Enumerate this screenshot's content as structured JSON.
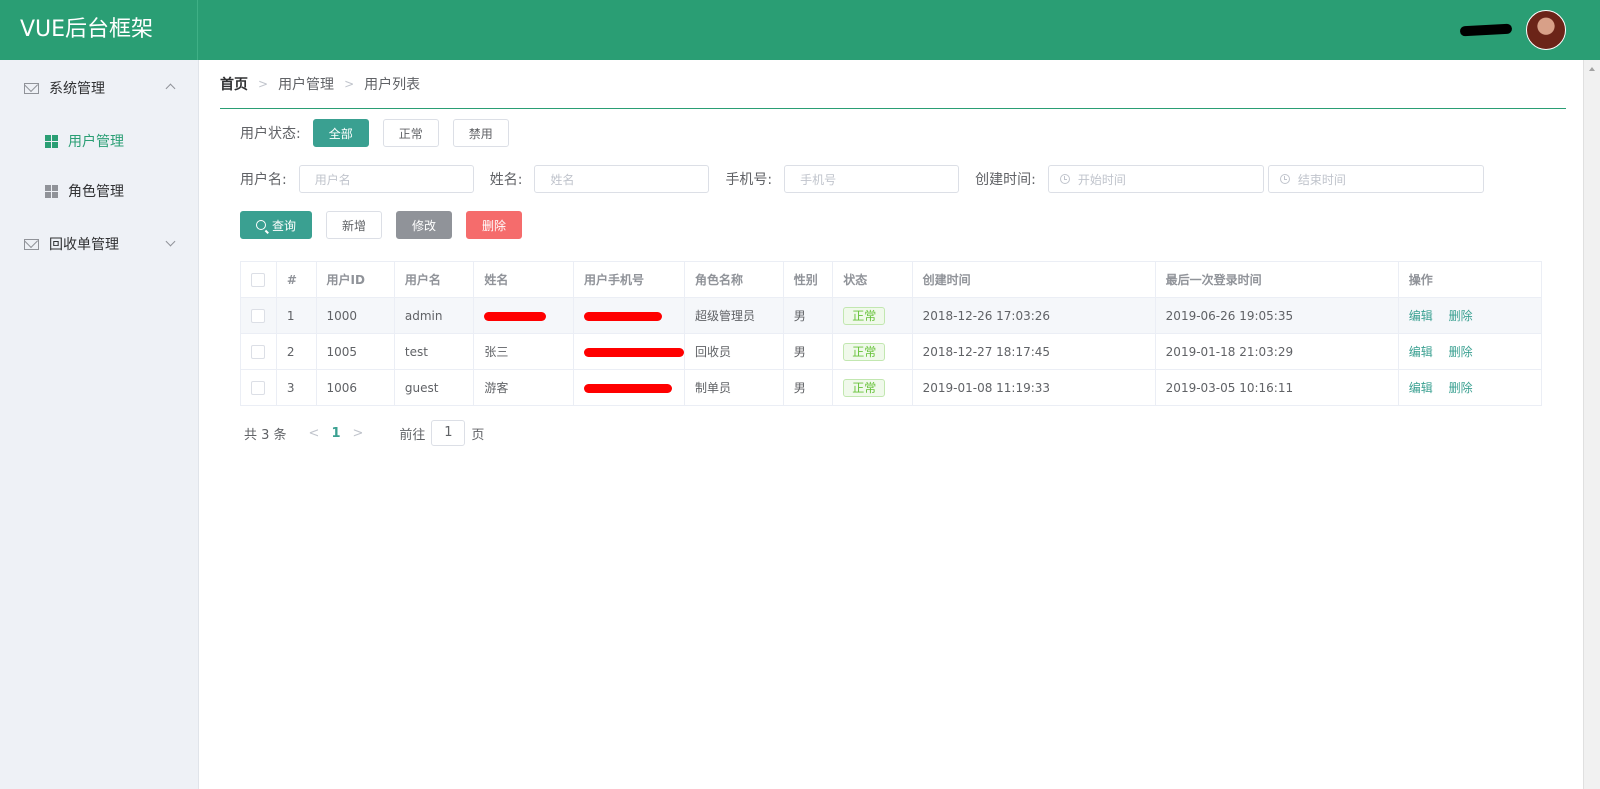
{
  "app": {
    "title": "VUE后台框架"
  },
  "sidebar": {
    "groups": [
      {
        "label": "系统管理",
        "items": [
          {
            "label": "用户管理"
          },
          {
            "label": "角色管理"
          }
        ]
      },
      {
        "label": "回收单管理"
      }
    ]
  },
  "breadcrumb": [
    "首页",
    "用户管理",
    "用户列表"
  ],
  "filters": {
    "status_label": "用户状态:",
    "status_options": [
      "全部",
      "正常",
      "禁用"
    ],
    "username_label": "用户名:",
    "username_placeholder": "用户名",
    "name_label": "姓名:",
    "name_placeholder": "姓名",
    "phone_label": "手机号:",
    "phone_placeholder": "手机号",
    "created_label": "创建时间:",
    "start_placeholder": "开始时间",
    "end_placeholder": "结束时间"
  },
  "actions": {
    "query": "查询",
    "add": "新增",
    "edit": "修改",
    "delete": "删除"
  },
  "table": {
    "headers": [
      "#",
      "用户ID",
      "用户名",
      "姓名",
      "用户手机号",
      "角色名称",
      "性别",
      "状态",
      "创建时间",
      "最后一次登录时间",
      "操作"
    ],
    "rows": [
      {
        "idx": "1",
        "id": "1000",
        "username": "admin",
        "name": "",
        "phone": "",
        "role": "超级管理员",
        "gender": "男",
        "status": "正常",
        "created": "2018-12-26 17:03:26",
        "last_login": "2019-06-26 19:05:35"
      },
      {
        "idx": "2",
        "id": "1005",
        "username": "test",
        "name": "张三",
        "phone": "",
        "role": "回收员",
        "gender": "男",
        "status": "正常",
        "created": "2018-12-27 18:17:45",
        "last_login": "2019-01-18 21:03:29"
      },
      {
        "idx": "3",
        "id": "1006",
        "username": "guest",
        "name": "游客",
        "phone": "",
        "role": "制单员",
        "gender": "男",
        "status": "正常",
        "created": "2019-01-08 11:19:33",
        "last_login": "2019-03-05 10:16:11"
      }
    ],
    "row_ops": {
      "edit": "编辑",
      "delete": "删除"
    }
  },
  "pagination": {
    "total": "共 3 条",
    "current": "1",
    "goto_label": "前往",
    "goto_value": "1",
    "page_suffix": "页"
  },
  "colors": {
    "header": "#2a9e74",
    "primary": "#3aa091",
    "danger": "#f56c6c"
  }
}
